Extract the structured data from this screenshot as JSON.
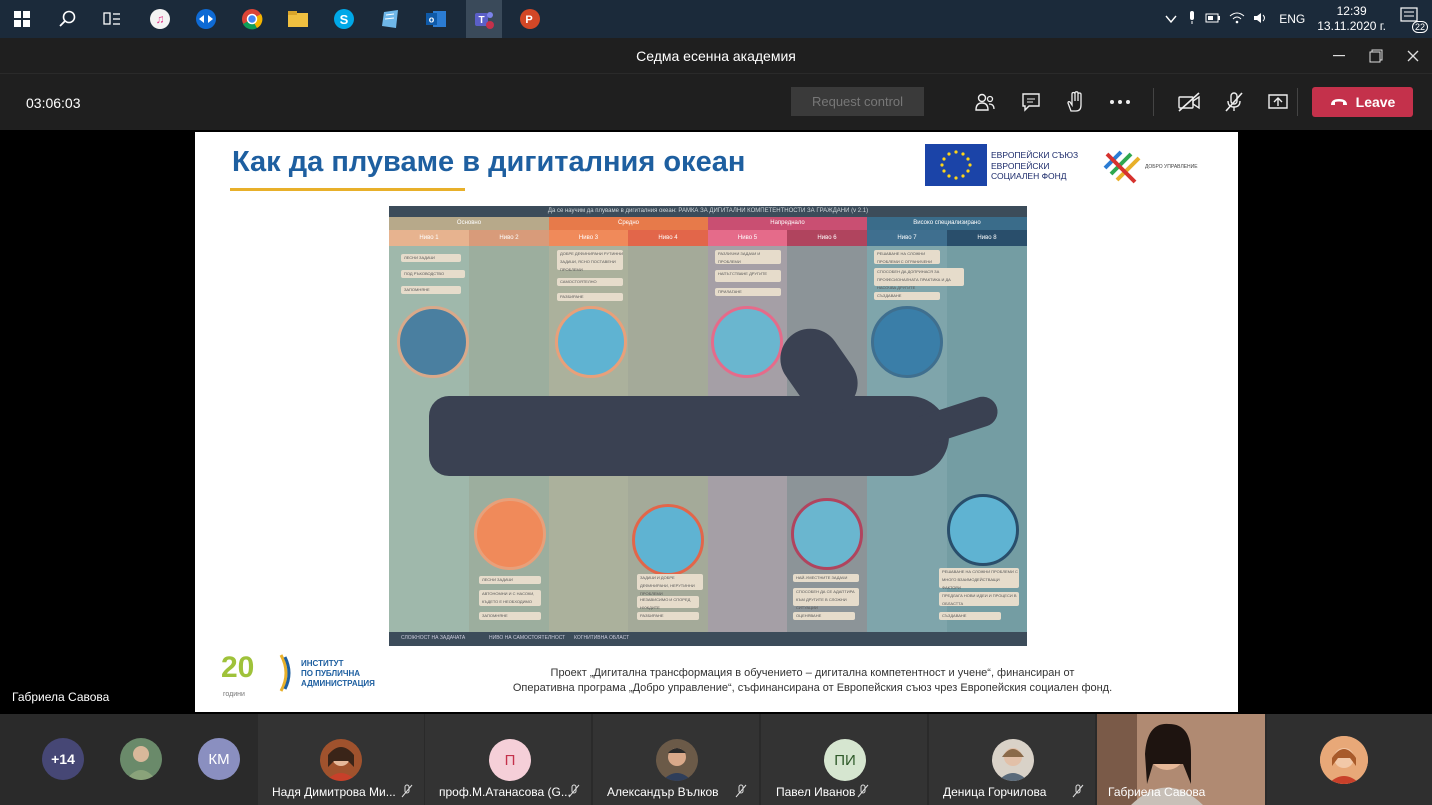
{
  "taskbar": {
    "icons": [
      "windows-icon",
      "search-icon",
      "task-view-icon",
      "itunes-icon",
      "teamviewer-icon",
      "chrome-icon",
      "file-explorer-icon",
      "skype-icon",
      "notepad-icon",
      "outlook-icon",
      "teams-icon",
      "powerpoint-icon"
    ],
    "language": "ENG",
    "time": "12:39",
    "date": "13.11.2020 г.",
    "notification_count": "22"
  },
  "window": {
    "title": "Седма есенна академия"
  },
  "toolbar": {
    "timer": "03:06:03",
    "request_control": "Request control",
    "leave": "Leave"
  },
  "slide": {
    "title": "Как  да плуваме в дигиталния океан",
    "eu_logo_text": [
      "ЕВРОПЕЙСКИ СЪЮЗ",
      "ЕВРОПЕЙСКИ",
      "СОЦИАЛЕН ФОНД"
    ],
    "dobro_text": "ДОБРО УПРАВЛЕНИЕ",
    "infographic": {
      "header": "Да се научим да плуваме в дигиталния океан: РАМКА ЗА ДИГИТАЛНИ КОМПЕТЕНТНОСТИ ЗА ГРАЖДАНИ (v 2.1)",
      "categories": [
        "Основно",
        "Средно",
        "Напреднало",
        "Високо специализирано"
      ],
      "levels": [
        "Ниво 1",
        "Ниво 2",
        "Ниво 3",
        "Ниво 4",
        "Ниво 5",
        "Ниво 6",
        "Ниво 7",
        "Ниво 8"
      ],
      "level_colors": [
        "#e7b38f",
        "#d89b7a",
        "#f08a5a",
        "#e2664a",
        "#e56b8a",
        "#b0445e",
        "#3f6f8f",
        "#294e6b"
      ],
      "column_colors": [
        "#cfd6c2",
        "#c9c2a8",
        "#e8c7a4",
        "#d9b99d",
        "#dba3b8",
        "#a98e9c",
        "#8fb0c2",
        "#7a9fb2"
      ],
      "top_notes": {
        "col1": [
          "ЛЕСНИ ЗАДАЧИ",
          "ПОД РЪКОВОДСТВО",
          "ЗАПОМНЯНЕ"
        ],
        "col3": [
          "ДОБРЕ ДЕФИНИРАНИ РУТИННИ ЗАДАЧИ, ЯСНО ПОСТАВЕНИ ПРОБЛЕМИ",
          "САМОСТОЯТЕЛНО",
          "РАЗБИРАНЕ"
        ],
        "col5": [
          "РАЗЛИЧНИ ЗАДАЧИ И ПРОБЛЕМИ",
          "НАПЪТСТВАНЕ ДРУГИТЕ",
          "ПРИЛАГАНЕ"
        ],
        "col7": [
          "РЕШАВАНЕ НА СЛОЖНИ ПРОБЛЕМИ С ОГРАНИЧЕНИ РЕШЕНИЯ",
          "СПОСОБЕН ДА ДОПРИНАСЯ ЗА ПРОФЕСИОНАЛНАТА ПРАКТИКА И ДА НАСОЧВА ДРУГИТЕ",
          "СЪЗДАВАНЕ"
        ]
      },
      "bottom_notes": {
        "col1": [
          "ЛЕСНИ ЗАДАЧИ",
          "АВТОНОМНИ И С НАСОКИ, КЪДЕТО Е НЕОБХОДИМО",
          "ЗАПОМНЯНЕ"
        ],
        "col3": [
          "ЗАДАЧИ И ДОБРЕ ДЕФИНИРАНИ, НЕРУТИННИ ПРОБЛЕМИ",
          "НЕЗАВИСИМО И СПОРЕД НУЖДИТЕ",
          "РАЗБИРАНЕ"
        ],
        "col5": [
          "НАЙ-УМЕСТНИТЕ ЗАДАЧИ",
          "СПОСОБЕН ДА СЕ АДАПТИРА КЪМ ДРУГИТЕ В СЛОЖНИ СИТУАЦИИ",
          "ОЦЕНЯВАНЕ"
        ],
        "col7": [
          "РЕШАВАНЕ НА СЛОЖНИ ПРОБЛЕМИ С МНОГО ВЗАИМОДЕЙСТВАЩИ ФАКТОРИ",
          "ПРЕДЛАГА НОВИ ИДЕИ И ПРОЦЕСИ В ОБЛАСТТА",
          "СЪЗДАВАНЕ"
        ]
      },
      "legend": [
        "СЛОЖНОСТ НА ЗАДАЧАТА",
        "НИВО НА САМОСТОЯТЕЛНОСТ",
        "КОГНИТИВНА ОБЛАСТ"
      ]
    },
    "ipa_logo": {
      "years": "20",
      "years_label": "години",
      "line1": "ИНСТИТУТ",
      "line2": "ПО ПУБЛИЧНА",
      "line3": "АДМИНИСТРАЦИЯ"
    },
    "project_text_line1": "Проект „Дигитална трансформация в обучението – дигитална компетентност и учене“, финансиран от",
    "project_text_line2": "Оперативна програма „Добро управление“, съфинансирана от Европейския съюз чрез Европейския социален фонд."
  },
  "presenter_name": "Габриела Савова",
  "participants": {
    "more_count": "+14",
    "km_initials": "КМ",
    "tiles": [
      {
        "name": "Надя Димитрова Ми...",
        "initials": "",
        "muted": true
      },
      {
        "name": "проф.М.Атанасова (G...",
        "initials": "П",
        "muted": true
      },
      {
        "name": "Александър Вълков",
        "initials": "",
        "muted": true
      },
      {
        "name": "Павел Иванов",
        "initials": "ПИ",
        "muted": true
      },
      {
        "name": "Деница Горчилова",
        "initials": "",
        "muted": true
      },
      {
        "name": "Габриела Савова",
        "initials": "",
        "muted": false
      },
      {
        "name": "",
        "initials": "",
        "muted": false
      }
    ]
  },
  "colors": {
    "leave": "#c4314b",
    "title_blue": "#1e5fa0",
    "accent_yellow": "#e8b02a"
  }
}
